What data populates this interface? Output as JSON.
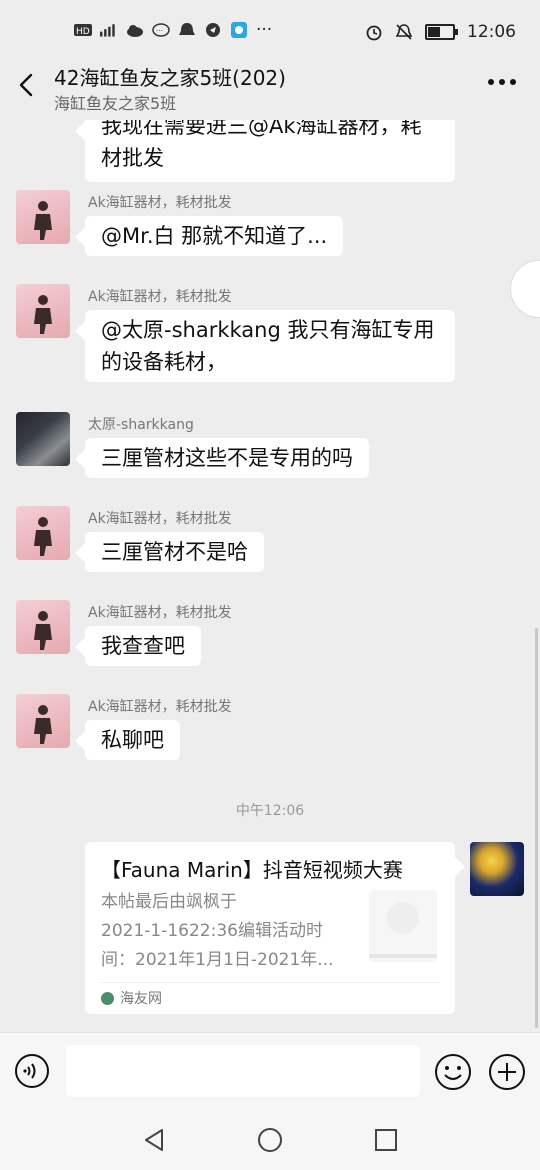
{
  "status_bar": {
    "left_icons": [
      "hd-icon",
      "signal-icon",
      "cloud-icon",
      "chat-bubble-icon",
      "notification-icon",
      "shield-icon",
      "app-icon"
    ],
    "ellipsis": "···",
    "time": "12:06",
    "battery_level": 0.55
  },
  "header": {
    "title": "42海缸鱼友之家5班(202)",
    "subtitle": "海缸鱼友之家5班",
    "more": "•••"
  },
  "messages": [
    {
      "type": "partial",
      "text_line1": "我现在需要进三@Ak海缸器材，耗",
      "text_line2": "材批发"
    },
    {
      "sender": "Ak海缸器材，耗材批发",
      "text": "@Mr.白  那就不知道了..."
    },
    {
      "sender": "Ak海缸器材，耗材批发",
      "text_line1": "@太原-sharkkang  我只有海缸专用",
      "text_line2": "的设备耗材，"
    },
    {
      "sender": "太原-sharkkang",
      "text": "三厘管材这些不是专用的吗"
    },
    {
      "sender": "Ak海缸器材，耗材批发",
      "text": "三厘管材不是哈"
    },
    {
      "sender": "Ak海缸器材，耗材批发",
      "text": "我查查吧"
    },
    {
      "sender": "Ak海缸器材，耗材批发",
      "text": "私聊吧"
    }
  ],
  "timestamp": "中午12:06",
  "link_card": {
    "title": "【Fauna Marin】抖音短视频大赛",
    "desc_line1": "本帖最后由飒枫于",
    "desc_line2": "2021-1-1622:36编辑活动时",
    "desc_line3": "间：2021年1月1日-2021年...",
    "source": "海友网"
  },
  "input": {
    "placeholder": ""
  }
}
